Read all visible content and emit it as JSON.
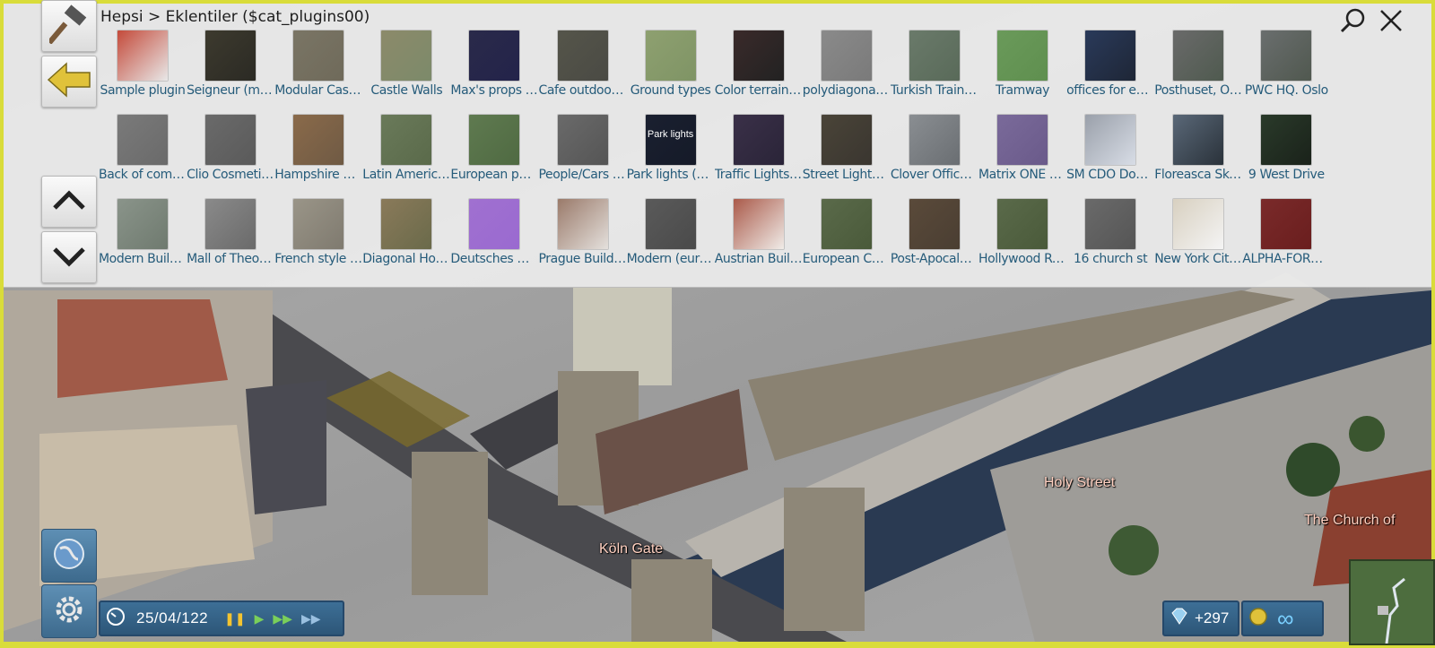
{
  "breadcrumb": "Hepsi > Eklentiler ($cat_plugins00)",
  "plugins": [
    {
      "label": "Sample plugin",
      "color": "#c44a3a",
      "bg": "#e8e8e8"
    },
    {
      "label": "Seigneur (medie...",
      "color": "#3d3a2e",
      "bg": "#2b2a24"
    },
    {
      "label": "Modular Castle",
      "color": "#7a7565",
      "bg": "#6f6a5a"
    },
    {
      "label": "Castle Walls",
      "color": "#8c8a6a",
      "bg": "#7c8a6a"
    },
    {
      "label": "Max's props exp...",
      "color": "#2a2a4a",
      "bg": "#23234a"
    },
    {
      "label": "Cafe outdoor ta...",
      "color": "#55554a",
      "bg": "#4a4a44"
    },
    {
      "label": "Ground types",
      "color": "#8ea070",
      "bg": "#7f9465"
    },
    {
      "label": "Color terrain an...",
      "color": "#3a2a2a",
      "bg": "#222222"
    },
    {
      "label": "polydiagonal de...",
      "color": "#8a8a8a",
      "bg": "#7a7a7a"
    },
    {
      "label": "Turkish Trains a...",
      "color": "#6a7a6a",
      "bg": "#596a59"
    },
    {
      "label": "Tramway",
      "color": "#6a9a5a",
      "bg": "#5f8f4f"
    },
    {
      "label": "offices for empl...",
      "color": "#2a3a5a",
      "bg": "#1e2636"
    },
    {
      "label": "Posthuset, Oslo",
      "color": "#6a6a6a",
      "bg": "#4f5a4f"
    },
    {
      "label": "PWC HQ. Oslo",
      "color": "#6a6e6e",
      "bg": "#50584f"
    },
    {
      "label": "Back of commer...",
      "color": "#7a7a7a",
      "bg": "#6a6a6a"
    },
    {
      "label": "Clio Cosmetics...",
      "color": "#6a6a6a",
      "bg": "#5a5a5a"
    },
    {
      "label": "Hampshire Coff...",
      "color": "#8a6a4a",
      "bg": "#6f5a44"
    },
    {
      "label": "Latin American...",
      "color": "#6a7a5a",
      "bg": "#5a6a4a"
    },
    {
      "label": "European peopl...",
      "color": "#5f7a50",
      "bg": "#4f6a42"
    },
    {
      "label": "People/Cars De...",
      "color": "#6a6a6a",
      "bg": "#555555"
    },
    {
      "label": "Park lights (with...",
      "color": "#1a2030",
      "bg": "#151a28",
      "overlay": "Park lights"
    },
    {
      "label": "Traffic Lights v.2...",
      "color": "#3a3048",
      "bg": "#2a2438"
    },
    {
      "label": "Street Lights (U...",
      "color": "#4a4438",
      "bg": "#3a3630"
    },
    {
      "label": "Clover Office Co...",
      "color": "#8a8e92",
      "bg": "#6a6e72"
    },
    {
      "label": "Matrix ONE Lab...",
      "color": "#7a6a9a",
      "bg": "#6a5a8a"
    },
    {
      "label": "SM CDO Downt...",
      "color": "#9aa0aa",
      "bg": "#d8dde6"
    },
    {
      "label": "Floreasca SkyTo...",
      "color": "#5a6878",
      "bg": "#2a323a"
    },
    {
      "label": "9 West Drive",
      "color": "#2a3a2a",
      "bg": "#1a221a"
    },
    {
      "label": "Modern Building...",
      "color": "#8a948a",
      "bg": "#6f7a6f"
    },
    {
      "label": "Mall of Theonia",
      "color": "#8a8a8a",
      "bg": "#6a6a6a"
    },
    {
      "label": "French style buil...",
      "color": "#9a9588",
      "bg": "#7f7a6f"
    },
    {
      "label": "Diagonal House...",
      "color": "#8a7a5a",
      "bg": "#6a6a4a"
    },
    {
      "label": "Deutsches Haus...",
      "color": "#a070d0",
      "bg": "#9a6ad0"
    },
    {
      "label": "Prague Buildings",
      "color": "#9a7a6a",
      "bg": "#e4e0dc"
    },
    {
      "label": "Modern (euro) b...",
      "color": "#5a5a5a",
      "bg": "#4a4a4a"
    },
    {
      "label": "Austrian Buildings",
      "color": "#aa5a4a",
      "bg": "#f0ece8"
    },
    {
      "label": "European Church",
      "color": "#5a6a4a",
      "bg": "#4a5a3a"
    },
    {
      "label": "Post-Apocalyps...",
      "color": "#5a4a3a",
      "bg": "#4a3e32"
    },
    {
      "label": "Hollywood Roo...",
      "color": "#5a6a4a",
      "bg": "#4a5a3a"
    },
    {
      "label": "16 church st",
      "color": "#6a6a6a",
      "bg": "#555555"
    },
    {
      "label": "New York City A...",
      "color": "#d8d0c0",
      "bg": "#f4f4f4"
    },
    {
      "label": "ALPHA-FORES...",
      "color": "#7a2a2a",
      "bg": "#6a1e1e"
    }
  ],
  "map_labels": [
    "Holy Street",
    "Köln Gate",
    "The Church of"
  ],
  "status": {
    "date": "25/04/122",
    "money": "+297",
    "budget": "∞"
  },
  "colors": {
    "panel_bg": "#ececec",
    "label_text": "#255b7a",
    "status_bar": "#3d6f96",
    "frame": "#d9dc3a"
  },
  "icons": {
    "build": "hammer-icon",
    "back": "back-arrow-icon",
    "up": "chevron-up-icon",
    "down": "chevron-down-icon",
    "search": "search-icon",
    "close": "close-icon",
    "world": "globe-icon",
    "settings": "gear-icon",
    "clock": "clock-icon",
    "money": "diamond-icon",
    "coin": "coin-icon"
  }
}
